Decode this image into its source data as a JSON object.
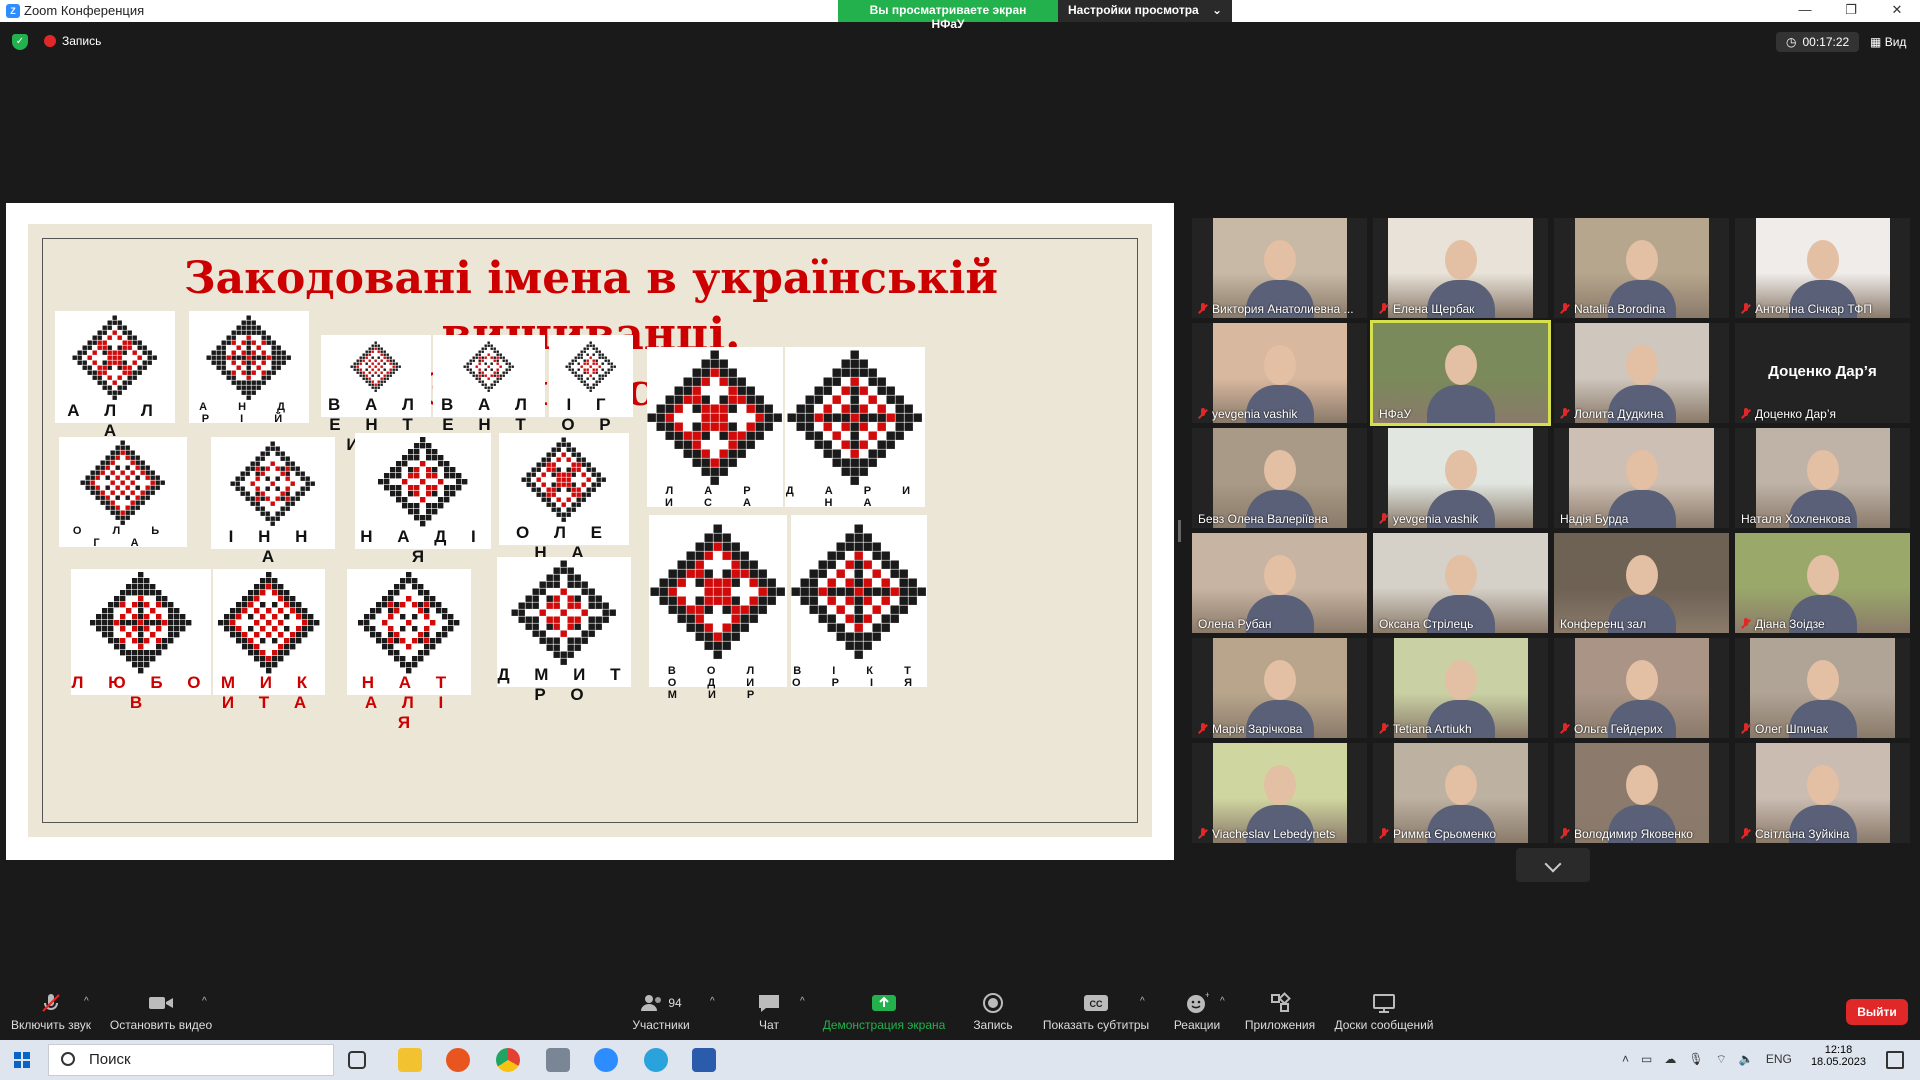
{
  "window": {
    "title": "Zoom Конференция",
    "share_notice": "Вы просматриваете экран НФаУ",
    "view_settings": "Настройки просмотра",
    "min": "—",
    "max": "❐",
    "close": "✕"
  },
  "topbar": {
    "recording": "Запись",
    "timer": "00:17:22",
    "view": "Вид"
  },
  "slide": {
    "title_line1": "Закодовані імена в українській вишиванці.",
    "title_line2": "Знайди своє!",
    "names": [
      "А Л Л А",
      "А Н Д Р І Й",
      "В А Л Е Н Т И Н",
      "В А Л Е Н Т И Н А",
      "І Г О Р",
      "Л А Р И С А",
      "Д А Р И Н А",
      "О Л Ь Г А",
      "І Н Н А",
      "Н А Д І Я",
      "О Л Е Н А",
      "Л Ю Б О В",
      "М И К И Т А",
      "Н А Т А Л І Я",
      "Д М И Т Р О",
      "В О Л О Д И М И Р",
      "В І К Т О Р І Я"
    ],
    "colors": {
      "red": "#d10a0a",
      "black": "#1a1a1a",
      "bg": "#ece6d6"
    }
  },
  "participants": [
    "Виктория Анатолиевна ...",
    "Елена Щербак",
    "Nataliia Borodina",
    "Антоніна Січкар ТФП",
    "yevgenia vashik",
    "НФаУ",
    "Лолита Дудкина",
    "Доценко Дар’я",
    "Бевз Олена Валеріївна",
    "yevgenia vashik",
    "Надія Бурда",
    "Наталя Хохленкова",
    "Олена Рубан",
    "Оксана Стрілець",
    "Конференц зал",
    "Діана Зоідзе",
    "Марія Зарічкова",
    "Tetiana Artiukh",
    "Ольга Гейдерих",
    "Олег Шпичак",
    "Viacheslav Lebedynets",
    "Римма Єрьоменко",
    "Володимир Яковенко",
    "Світлана Зуйкіна"
  ],
  "name_only_tile": "Доценко Дар’я",
  "toolbar": {
    "unmute": "Включить звук",
    "stop_video": "Остановить видео",
    "participants": "Участники",
    "participants_count": "94",
    "chat": "Чат",
    "share": "Демонстрация экрана",
    "record": "Запись",
    "captions": "Показать субтитры",
    "reactions": "Реакции",
    "apps": "Приложения",
    "whiteboards": "Доски сообщений",
    "leave": "Выйти"
  },
  "taskbar": {
    "search": "Поиск",
    "lang": "ENG",
    "time": "12:18",
    "date": "18.05.2023"
  }
}
